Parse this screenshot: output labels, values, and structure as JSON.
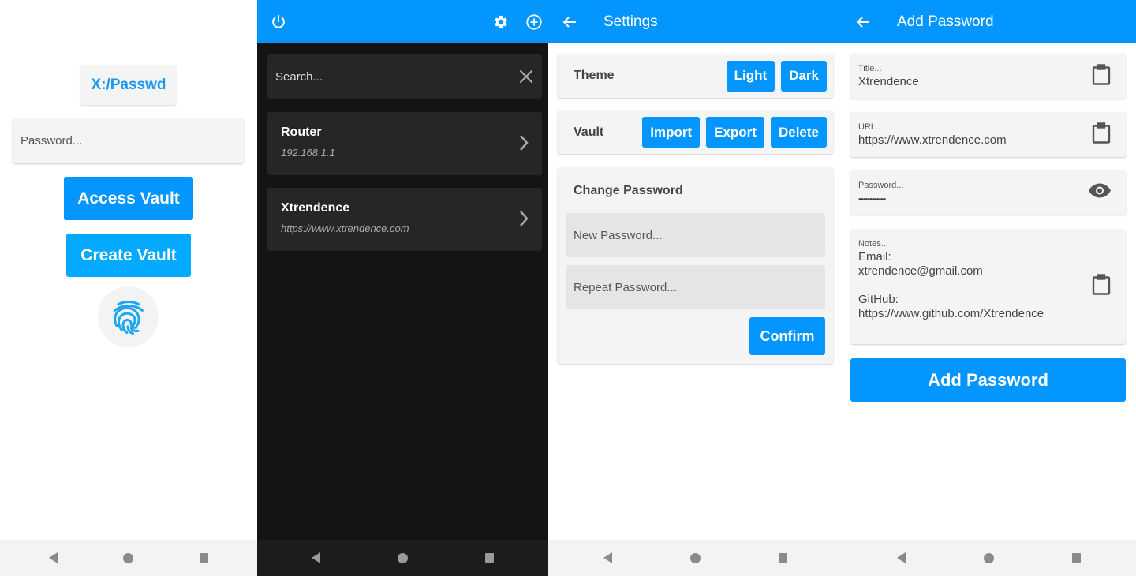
{
  "colors": {
    "accent": "#0396ff",
    "accent_light": "#03aaff",
    "dark_bg": "#141414",
    "dark_card": "#262626",
    "card_bg": "#f4f4f4"
  },
  "login": {
    "logo_text": "X:/Passwd",
    "password_placeholder": "Password...",
    "access_label": "Access Vault",
    "create_label": "Create Vault",
    "fingerprint_icon": "fingerprint-icon"
  },
  "vault": {
    "header_icons": [
      "power-icon",
      "gear-icon",
      "add-circle-icon"
    ],
    "search_placeholder": "Search...",
    "entries": [
      {
        "name": "Router",
        "sub": "192.168.1.1"
      },
      {
        "name": "Xtrendence",
        "sub": "https://www.xtrendence.com"
      }
    ]
  },
  "settings": {
    "title": "Settings",
    "theme_label": "Theme",
    "theme_buttons": [
      "Light",
      "Dark"
    ],
    "vault_label": "Vault",
    "vault_buttons": [
      "Import",
      "Export",
      "Delete"
    ],
    "change_password_title": "Change Password",
    "new_password_placeholder": "New Password...",
    "repeat_password_placeholder": "Repeat Password...",
    "confirm_label": "Confirm"
  },
  "add_password": {
    "title": "Add Password",
    "fields": {
      "title": {
        "label": "Title...",
        "value": "Xtrendence"
      },
      "url": {
        "label": "URL...",
        "value": "https://www.xtrendence.com"
      },
      "password": {
        "label": "Password...",
        "value": "••••••••••••"
      },
      "notes": {
        "label": "Notes...",
        "value": "Email:\nxtrendence@gmail.com\n\nGitHub:\nhttps://www.github.com/Xtrendence"
      }
    },
    "submit_label": "Add Password"
  }
}
